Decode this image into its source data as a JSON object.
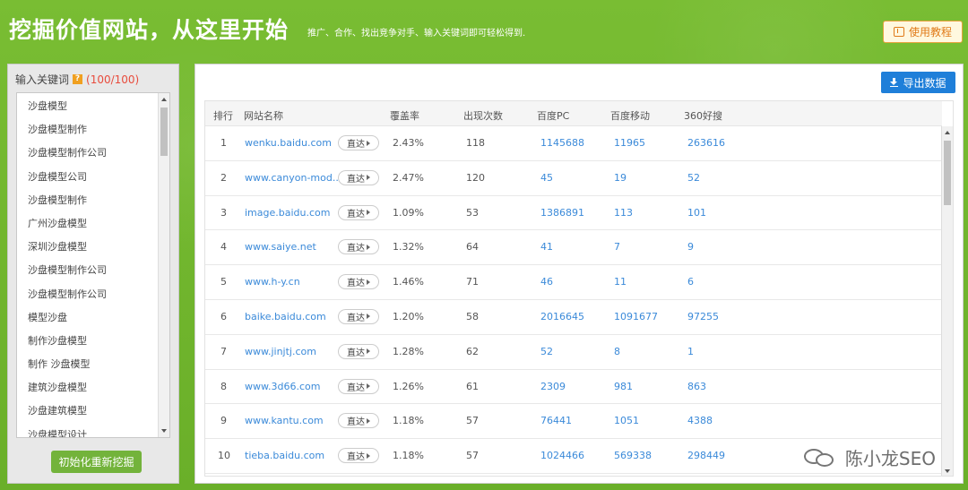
{
  "header": {
    "title": "挖掘价值网站，从这里开始",
    "subtitle": "推广、合作、找出竞争对手、输入关键词即可轻松得到.",
    "help_label": "使用教程"
  },
  "left_panel": {
    "label": "输入关键词",
    "help_icon": "?",
    "count": "(100/100)",
    "keywords": [
      "沙盘模型",
      "沙盘模型制作",
      "沙盘模型制作公司",
      "沙盘模型公司",
      "沙盘模型制作",
      "广州沙盘模型",
      "深圳沙盘模型",
      "沙盘模型制作公司",
      "沙盘模型制作公司",
      "模型沙盘",
      "制作沙盘模型",
      "制作 沙盘模型",
      "建筑沙盘模型",
      "沙盘建筑模型",
      "沙盘模型设计"
    ],
    "reset_label": "初始化重新挖掘"
  },
  "right_panel": {
    "export_label": "导出数据",
    "columns": [
      "排行",
      "网站名称",
      "覆盖率",
      "出现次数",
      "百度PC",
      "百度移动",
      "360好搜"
    ],
    "go_label": "直达",
    "rows": [
      {
        "rank": "1",
        "site": "wenku.baidu.com",
        "coverage": "2.43%",
        "count": "118",
        "pc": "1145688",
        "mobile": "11965",
        "so360": "263616"
      },
      {
        "rank": "2",
        "site": "www.canyon-mod...",
        "coverage": "2.47%",
        "count": "120",
        "pc": "45",
        "mobile": "19",
        "so360": "52"
      },
      {
        "rank": "3",
        "site": "image.baidu.com",
        "coverage": "1.09%",
        "count": "53",
        "pc": "1386891",
        "mobile": "113",
        "so360": "101"
      },
      {
        "rank": "4",
        "site": "www.saiye.net",
        "coverage": "1.32%",
        "count": "64",
        "pc": "41",
        "mobile": "7",
        "so360": "9"
      },
      {
        "rank": "5",
        "site": "www.h-y.cn",
        "coverage": "1.46%",
        "count": "71",
        "pc": "46",
        "mobile": "11",
        "so360": "6"
      },
      {
        "rank": "6",
        "site": "baike.baidu.com",
        "coverage": "1.20%",
        "count": "58",
        "pc": "2016645",
        "mobile": "1091677",
        "so360": "97255"
      },
      {
        "rank": "7",
        "site": "www.jinjtj.com",
        "coverage": "1.28%",
        "count": "62",
        "pc": "52",
        "mobile": "8",
        "so360": "1"
      },
      {
        "rank": "8",
        "site": "www.3d66.com",
        "coverage": "1.26%",
        "count": "61",
        "pc": "2309",
        "mobile": "981",
        "so360": "863"
      },
      {
        "rank": "9",
        "site": "www.kantu.com",
        "coverage": "1.18%",
        "count": "57",
        "pc": "76441",
        "mobile": "1051",
        "so360": "4388"
      },
      {
        "rank": "10",
        "site": "tieba.baidu.com",
        "coverage": "1.18%",
        "count": "57",
        "pc": "1024466",
        "mobile": "569338",
        "so360": "298449"
      }
    ]
  },
  "watermark": {
    "text": "陈小龙SEO"
  },
  "colors": {
    "background_green": "#6fb52c",
    "link_blue": "#3b8ad9",
    "export_blue": "#1f7fd9",
    "reset_green": "#73b33b",
    "help_orange": "#e07a18"
  }
}
